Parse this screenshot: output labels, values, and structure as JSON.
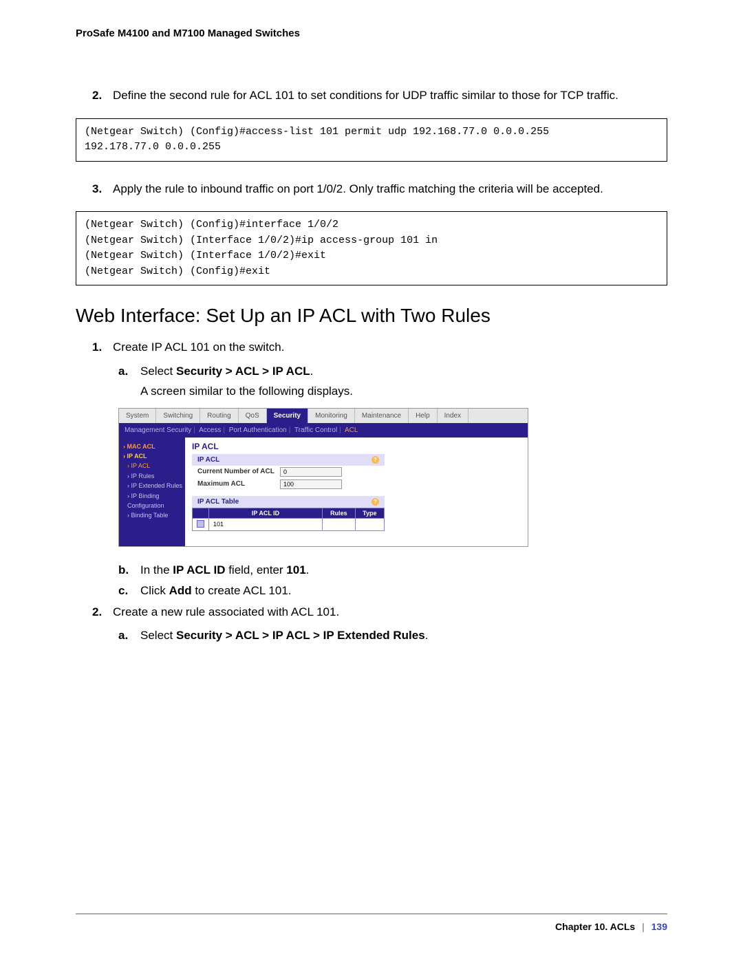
{
  "doc_header": "ProSafe M4100 and M7100 Managed Switches",
  "steps": {
    "step2": {
      "num": "2.",
      "text": "Define the second rule for ACL 101 to set conditions for UDP traffic similar to those for TCP traffic."
    },
    "code1": "(Netgear Switch) (Config)#access-list 101 permit udp 192.168.77.0 0.0.0.255 \n192.178.77.0 0.0.0.255",
    "step3": {
      "num": "3.",
      "text": "Apply the rule to inbound traffic on port 1/0/2. Only traffic matching the criteria will be accepted."
    },
    "code2": "(Netgear Switch) (Config)#interface 1/0/2\n(Netgear Switch) (Interface 1/0/2)#ip access-group 101 in\n(Netgear Switch) (Interface 1/0/2)#exit\n(Netgear Switch) (Config)#exit"
  },
  "heading": "Web Interface: Set Up an IP ACL with Two Rules",
  "proc": {
    "p1": {
      "num": "1.",
      "text": "Create IP ACL 101 on the switch."
    },
    "p1a": {
      "letter": "a.",
      "prefix": "Select ",
      "bold": "Security > ACL > IP ACL",
      "suffix": "."
    },
    "p1a_after": "A screen similar to the following displays.",
    "p1b": {
      "letter": "b.",
      "prefix": "In the ",
      "bold1": "IP ACL ID",
      "mid": " field, enter ",
      "bold2": "101",
      "suffix": "."
    },
    "p1c": {
      "letter": "c.",
      "prefix": "Click ",
      "bold": "Add",
      "suffix": " to create ACL 101."
    },
    "p2": {
      "num": "2.",
      "text": "Create a new rule associated with ACL 101."
    },
    "p2a": {
      "letter": "a.",
      "prefix": "Select ",
      "bold": "Security > ACL > IP ACL > IP Extended Rules",
      "suffix": "."
    }
  },
  "ui": {
    "tabs": [
      "System",
      "Switching",
      "Routing",
      "QoS",
      "Security",
      "Monitoring",
      "Maintenance",
      "Help",
      "Index"
    ],
    "active_tab": "Security",
    "subtabs": [
      "Management Security",
      "Access",
      "Port Authentication",
      "Traffic Control",
      "ACL"
    ],
    "active_subtab": "ACL",
    "sidebar": {
      "mac_acl": "MAC ACL",
      "ip_acl": "IP ACL",
      "items": [
        "IP ACL",
        "IP Rules",
        "IP Extended Rules",
        "IP Binding Configuration",
        "Binding Table"
      ]
    },
    "panel_title": "IP ACL",
    "box1": {
      "title": "IP ACL",
      "rows": [
        {
          "lbl": "Current Number of ACL",
          "val": "0"
        },
        {
          "lbl": "Maximum ACL",
          "val": "100"
        }
      ]
    },
    "box2": {
      "title": "IP ACL Table",
      "cols": [
        "IP ACL ID",
        "Rules",
        "Type"
      ],
      "input_val": "101"
    }
  },
  "footer": {
    "chapter": "Chapter 10.  ACLs",
    "page": "139"
  }
}
